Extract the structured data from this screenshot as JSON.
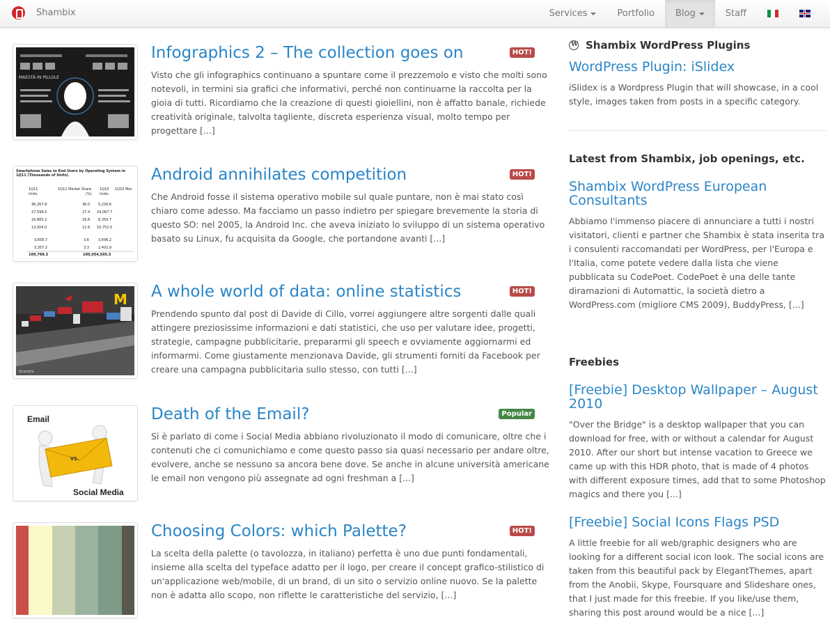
{
  "brand": {
    "name": "Shambix",
    "logo_icon": "shambix-logo-icon"
  },
  "nav": {
    "items": [
      {
        "label": "Services",
        "dropdown": true,
        "active": false
      },
      {
        "label": "Portfolio",
        "dropdown": false,
        "active": false
      },
      {
        "label": "Blog",
        "dropdown": true,
        "active": true
      },
      {
        "label": "Staff",
        "dropdown": false,
        "active": false
      }
    ],
    "flags": [
      "italian-flag-icon",
      "uk-flag-icon"
    ]
  },
  "posts": [
    {
      "title": "Infographics 2 – The collection goes on",
      "badge": "HOT!",
      "excerpt": "Visto che gli infographics continuano a spuntare come il prezzemolo e visto che molti sono notevoli, in termini sia grafici che informativi, perché non continuarne la raccolta per la gioia di tutti. Ricordiamo che la creazione di questi gioiellini, non è affatto banale, richiede creatività originale, talvolta tagliente, discreta esperienza visual, molto tempo per progettare [...]",
      "thumb_caption": "MAESTÀ IN PILLOLE"
    },
    {
      "title": "Android annihilates competition",
      "badge": "HOT!",
      "excerpt": "Che Android fosse il sistema operativo mobile sul quale puntare, non è mai stato così chiaro come adesso. Ma facciamo un passo indietro per spiegare brevemente la storia di questo SO: nel 2005, la Android Inc. che aveva iniziato lo sviluppo di un sistema operativo basato su Linux, fu acquisita da Google, che portandone avanti [...]",
      "thumb_caption": "Smartphone Sales to End Users by Operating System in 1Q11 (Thousands of Units)"
    },
    {
      "title": "A whole world of data: online statistics",
      "badge": "HOT!",
      "excerpt": "Prendendo spunto dal post di Davide di Cillo, vorrei aggiungere altre sorgenti dalle quali attingere preziosissime informazioni e dati statistici, che uso per valutare idee, progetti, strategie, campagne pubblicitarie, prepararmi gli speech e ovviamente aggiornarmi ed informarmi. Come giustamente menzionava Davide, gli strumenti forniti da Facebook per creare una campagna pubblicitaria sullo stesso, con tutti [...]",
      "thumb_caption": "Shambix"
    },
    {
      "title": "Death of the Email?",
      "badge": "Popular",
      "excerpt": "Si è parlato di come i Social Media abbiano rivoluzionato il modo di comunicare, oltre che i contenuti che ci comunichiamo e come questo passo sia quasi necessario per andare oltre, evolvere, anche se nessuno sa ancora bene dove. Se anche in alcune università americane le email non vengono più assegnate ad ogni freshman a [...]",
      "thumb_caption_top": "Email",
      "thumb_caption_mid": "vs.",
      "thumb_caption_bottom": "Social Media"
    },
    {
      "title": "Choosing Colors: which Palette?",
      "badge": "HOT!",
      "excerpt": "La scelta della palette (o tavolozza, in italiano) perfetta è uno due punti fondamentali, insieme alla scelta del typeface adatto per il logo, per creare il concept grafico-stilistico di un'applicazione web/mobile, di un brand, di un sito o servizio online nuovo. Se la palette non è adatta allo scopo, non riflette le caratteristiche del servizio, [...]",
      "palette": [
        "#c9504a",
        "#fcf9c8",
        "#c7d1b2",
        "#9ab39f",
        "#7e9b87",
        "#5a584a"
      ]
    }
  ],
  "sidebar": {
    "plugins": {
      "heading": "Shambix WordPress Plugins",
      "icon": "wordpress-icon",
      "post_title": "WordPress Plugin: iSlidex",
      "excerpt": "iSlidex is a Wordpress Plugin that will showcase, in a cool style, images taken from posts in a specific category."
    },
    "latest": {
      "heading": "Latest from Shambix, job openings, etc.",
      "post_title": "Shambix WordPress European Consultants",
      "excerpt": "Abbiamo l'immenso piacere di annunciare a tutti i nostri visitatori, clienti e partner che Shambix è stata inserita tra i consulenti raccomandati per WordPress, per l'Europa e l'Italia, come potete vedere dalla lista che viene pubblicata su CodePoet. CodePoet è una delle tante diramazioni di Automattic, la società dietro a WordPress.com (migliore CMS 2009), BuddyPress, [...]"
    },
    "freebies": {
      "heading": "Freebies",
      "items": [
        {
          "title": "[Freebie] Desktop Wallpaper – August 2010",
          "excerpt": "\"Over the Bridge\" is a desktop wallpaper that you can download for free, with or without a calendar for August 2010. After our short but intense vacation to Greece we came up with this HDR photo, that is made of 4 photos with different exposure times, add that to some Photoshop magics and there you [...]"
        },
        {
          "title": "[Freebie] Social Icons Flags PSD",
          "excerpt": "A little freebie for all web/graphic designers who are looking for a different social icon look. The social icons are taken from this beautiful pack by ElegantThemes, apart from the Anobii, Skype, Foursquare and Slideshare ones, that I just made for this freebie. If you like/use them, sharing this post around would be a nice [...]"
        }
      ]
    }
  },
  "colors": {
    "link": "#2a85c7",
    "hot_badge": "#b94a48",
    "popular_badge": "#468847"
  }
}
